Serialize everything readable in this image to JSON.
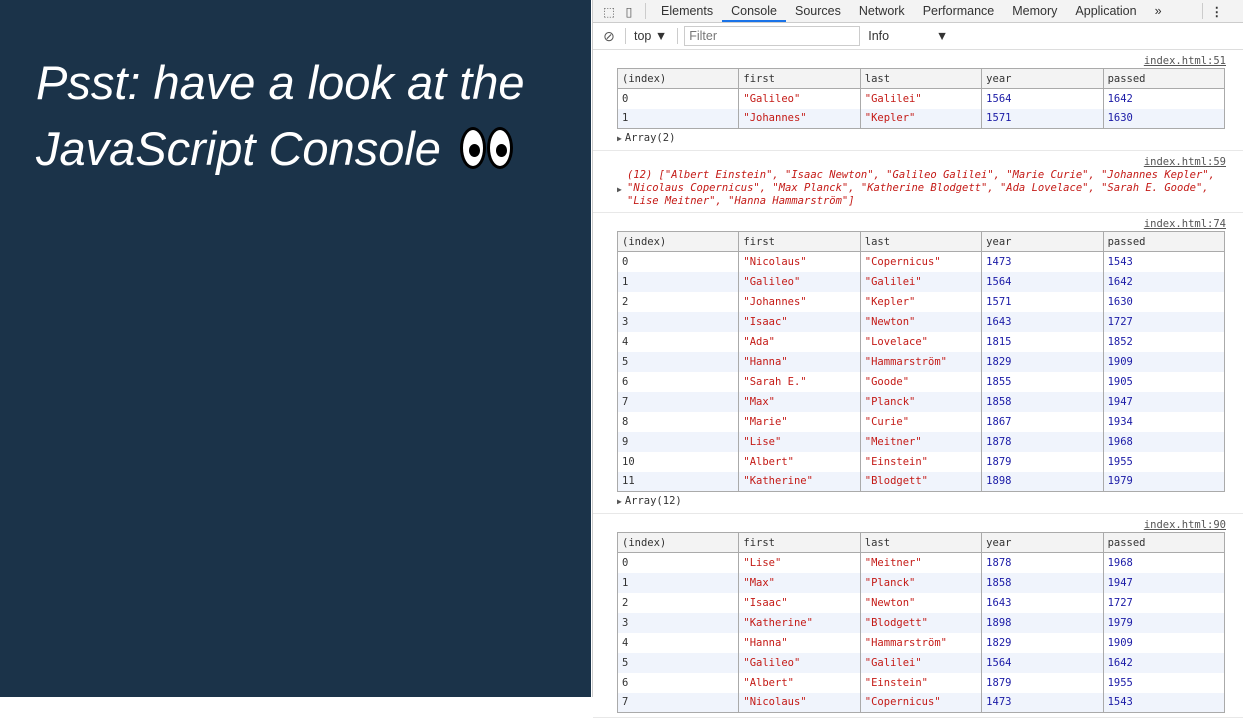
{
  "page": {
    "headline_line1": "Psst: have a look at the",
    "headline_line2": "JavaScript Console"
  },
  "devtools": {
    "tabs": [
      "Elements",
      "Console",
      "Sources",
      "Network",
      "Performance",
      "Memory",
      "Application"
    ],
    "more": "»",
    "menu": "⋮",
    "context": "top ▼",
    "filter_placeholder": "Filter",
    "level": "Info",
    "level_arrow": "▼"
  },
  "headers": [
    "(index)",
    "first",
    "last",
    "year",
    "passed"
  ],
  "messages": [
    {
      "source": "index.html:51",
      "rows": [
        [
          "0",
          "\"Galileo\"",
          "\"Galilei\"",
          "1564",
          "1642"
        ],
        [
          "1",
          "\"Johannes\"",
          "\"Kepler\"",
          "1571",
          "1630"
        ]
      ],
      "footer": "Array(2)"
    },
    {
      "source": "index.html:59",
      "text": "(12) [\"Albert Einstein\", \"Isaac Newton\", \"Galileo Galilei\", \"Marie Curie\", \"Johannes Kepler\", \"Nicolaus Copernicus\", \"Max Planck\", \"Katherine Blodgett\", \"Ada Lovelace\", \"Sarah E. Goode\", \"Lise Meitner\", \"Hanna Hammarström\"]"
    },
    {
      "source": "index.html:74",
      "rows": [
        [
          "0",
          "\"Nicolaus\"",
          "\"Copernicus\"",
          "1473",
          "1543"
        ],
        [
          "1",
          "\"Galileo\"",
          "\"Galilei\"",
          "1564",
          "1642"
        ],
        [
          "2",
          "\"Johannes\"",
          "\"Kepler\"",
          "1571",
          "1630"
        ],
        [
          "3",
          "\"Isaac\"",
          "\"Newton\"",
          "1643",
          "1727"
        ],
        [
          "4",
          "\"Ada\"",
          "\"Lovelace\"",
          "1815",
          "1852"
        ],
        [
          "5",
          "\"Hanna\"",
          "\"Hammarström\"",
          "1829",
          "1909"
        ],
        [
          "6",
          "\"Sarah E.\"",
          "\"Goode\"",
          "1855",
          "1905"
        ],
        [
          "7",
          "\"Max\"",
          "\"Planck\"",
          "1858",
          "1947"
        ],
        [
          "8",
          "\"Marie\"",
          "\"Curie\"",
          "1867",
          "1934"
        ],
        [
          "9",
          "\"Lise\"",
          "\"Meitner\"",
          "1878",
          "1968"
        ],
        [
          "10",
          "\"Albert\"",
          "\"Einstein\"",
          "1879",
          "1955"
        ],
        [
          "11",
          "\"Katherine\"",
          "\"Blodgett\"",
          "1898",
          "1979"
        ]
      ],
      "footer": "Array(12)"
    },
    {
      "source": "index.html:90",
      "rows": [
        [
          "0",
          "\"Lise\"",
          "\"Meitner\"",
          "1878",
          "1968"
        ],
        [
          "1",
          "\"Max\"",
          "\"Planck\"",
          "1858",
          "1947"
        ],
        [
          "2",
          "\"Isaac\"",
          "\"Newton\"",
          "1643",
          "1727"
        ],
        [
          "3",
          "\"Katherine\"",
          "\"Blodgett\"",
          "1898",
          "1979"
        ],
        [
          "4",
          "\"Hanna\"",
          "\"Hammarström\"",
          "1829",
          "1909"
        ],
        [
          "5",
          "\"Galileo\"",
          "\"Galilei\"",
          "1564",
          "1642"
        ],
        [
          "6",
          "\"Albert\"",
          "\"Einstein\"",
          "1879",
          "1955"
        ],
        [
          "7",
          "\"Nicolaus\"",
          "\"Copernicus\"",
          "1473",
          "1543"
        ]
      ]
    }
  ]
}
